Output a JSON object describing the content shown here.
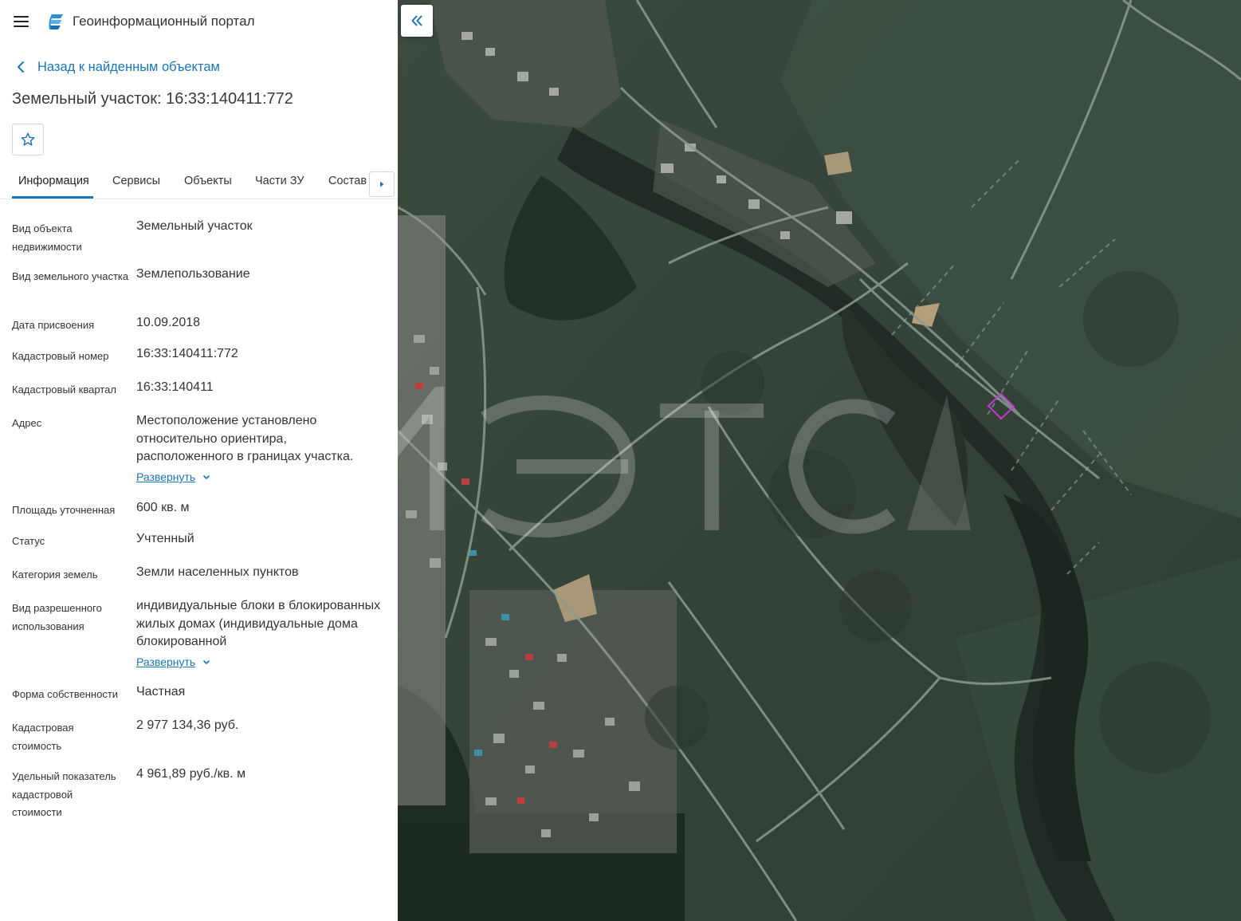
{
  "header": {
    "portal_title": "Геоинформационный портал",
    "menu_icon": "hamburger-menu-icon",
    "logo_icon": "portal-logo-icon"
  },
  "back_link": {
    "label": "Назад к найденным объектам"
  },
  "page_title": "Земельный участок: 16:33:140411:772",
  "favorite_icon": "star-icon",
  "tabs": [
    {
      "label": "Информация",
      "active": true
    },
    {
      "label": "Сервисы",
      "active": false
    },
    {
      "label": "Объекты",
      "active": false
    },
    {
      "label": "Части ЗУ",
      "active": false
    },
    {
      "label": "Состав",
      "active": false
    }
  ],
  "info": {
    "object_type": {
      "label": "Вид объекта недвижимости",
      "value": "Земельный участок"
    },
    "land_type": {
      "label": "Вид земельного участка",
      "value": "Землепользование"
    },
    "assign_date": {
      "label": "Дата присвоения",
      "value": "10.09.2018"
    },
    "cadastral_number": {
      "label": "Кадастровый номер",
      "value": "16:33:140411:772"
    },
    "cadastral_quarter": {
      "label": "Кадастровый квартал",
      "value": "16:33:140411"
    },
    "address": {
      "label": "Адрес",
      "value": "Местоположение установлено относительно ориентира, расположенного в границах участка.",
      "expand": "Развернуть"
    },
    "area": {
      "label": "Площадь уточненная",
      "value": "600 кв. м"
    },
    "status": {
      "label": "Статус",
      "value": "Учтенный"
    },
    "land_category": {
      "label": "Категория земель",
      "value": "Земли населенных пунктов"
    },
    "permitted_use": {
      "label": "Вид разрешенного использования",
      "value": "индивидуальные блоки в блокированных жилых домах (индивидуальные дома блокированной",
      "expand": "Развернуть"
    },
    "ownership": {
      "label": "Форма собственности",
      "value": "Частная"
    },
    "cadastral_value": {
      "label": "Кадастровая стоимость",
      "value": "2 977 134,36 руб."
    },
    "specific_value": {
      "label": "Удельный показатель кадастровой стоимости",
      "value": "4 961,89 руб./кв. м"
    }
  },
  "map": {
    "collapse_icon": "double-chevron-left-icon",
    "watermark": "МЭТС",
    "parcel_outline_color": "#c23bd4"
  },
  "colors": {
    "accent": "#1976b8",
    "text": "#333333",
    "border": "#cfd6dd"
  }
}
